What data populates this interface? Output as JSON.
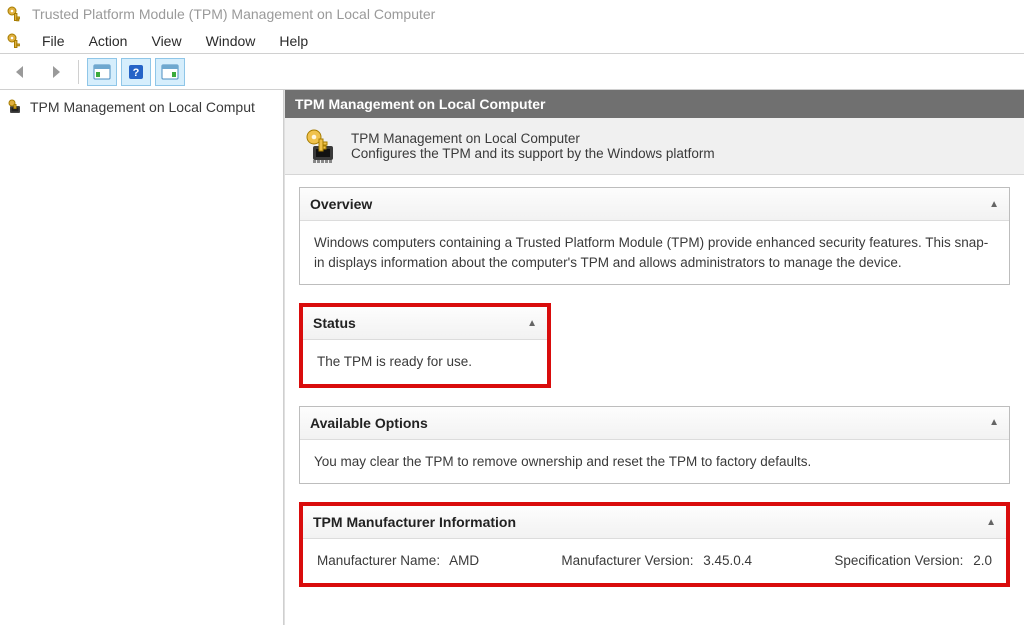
{
  "window": {
    "title": "Trusted Platform Module (TPM) Management on Local Computer"
  },
  "menu": {
    "items": [
      "File",
      "Action",
      "View",
      "Window",
      "Help"
    ]
  },
  "tree": {
    "node_label": "TPM Management on Local Comput"
  },
  "content": {
    "header": "TPM Management on Local Computer",
    "intro": {
      "line1": "TPM Management on Local Computer",
      "line2": "Configures the TPM and its support by the Windows platform"
    },
    "panels": {
      "overview": {
        "title": "Overview",
        "body": "Windows computers containing a Trusted Platform Module (TPM) provide enhanced security features. This snap-in displays information about the computer's TPM and allows administrators to manage the device."
      },
      "status": {
        "title": "Status",
        "body": "The TPM is ready for use."
      },
      "options": {
        "title": "Available Options",
        "body": "You may clear the TPM to remove ownership and reset the TPM to factory defaults."
      },
      "mfr": {
        "title": "TPM Manufacturer Information",
        "name_label": "Manufacturer Name",
        "name_value": "AMD",
        "version_label": "Manufacturer Version",
        "version_value": "3.45.0.4",
        "spec_label": "Specification Version",
        "spec_value": "2.0"
      }
    }
  }
}
